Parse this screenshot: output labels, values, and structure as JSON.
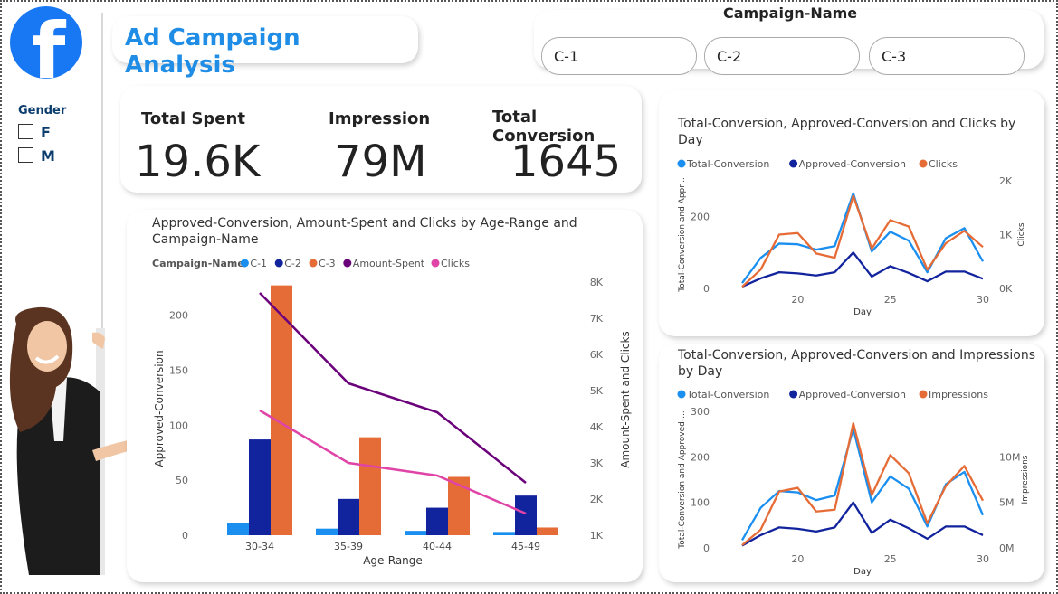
{
  "header": {
    "title": "Ad Campaign Analysis",
    "slicer_label": "Campaign-Name",
    "campaigns": [
      "C-1",
      "C-2",
      "C-3"
    ]
  },
  "sidebar": {
    "logo_icon": "facebook-logo-icon",
    "gender_label": "Gender",
    "gender_options": [
      "F",
      "M"
    ]
  },
  "kpis": [
    {
      "label": "Total Spent",
      "value": "19.6K"
    },
    {
      "label": "Impression",
      "value": "79M"
    },
    {
      "label": "Total Conversion",
      "value": "1645"
    }
  ],
  "colors": {
    "accent": "#1f8de6",
    "c1": "#1a8fef",
    "c2": "#12239e",
    "c3": "#e66c37",
    "amount_spent": "#6b007b",
    "clicks": "#e044a7"
  },
  "chart_data": [
    {
      "type": "bar",
      "title": "Approved-Conversion, Amount-Spent and Clicks by Age-Range and Campaign-Name",
      "legend_title": "Campaign-Name",
      "legend": [
        "C-1",
        "C-2",
        "C-3",
        "Amount-Spent",
        "Clicks"
      ],
      "categories": [
        "30-34",
        "35-39",
        "40-44",
        "45-49"
      ],
      "xlabel": "Age-Range",
      "ylabel": "Approved-Conversion",
      "y2label": "Amount-Spent and Clicks",
      "ylim": [
        0,
        230
      ],
      "yticks": [
        "0",
        "50",
        "100",
        "150",
        "200"
      ],
      "y2lim": [
        1000,
        8000
      ],
      "y2ticks": [
        "1K",
        "2K",
        "3K",
        "4K",
        "5K",
        "6K",
        "7K",
        "8K"
      ],
      "series": [
        {
          "name": "C-1",
          "values": [
            11,
            6,
            4,
            3
          ]
        },
        {
          "name": "C-2",
          "values": [
            87,
            33,
            25,
            36
          ]
        },
        {
          "name": "C-3",
          "values": [
            227,
            89,
            53,
            7
          ]
        },
        {
          "name": "Amount-Spent",
          "axis": "right",
          "values": [
            7700,
            5200,
            4400,
            2450
          ]
        },
        {
          "name": "Clicks",
          "axis": "right",
          "values": [
            4450,
            3000,
            2650,
            1600
          ]
        }
      ]
    },
    {
      "type": "line",
      "title": "Total-Conversion, Approved-Conversion and Clicks by Day",
      "legend": [
        "Total-Conversion",
        "Approved-Conversion",
        "Clicks"
      ],
      "xlabel": "Day",
      "ylabel": "Total-Conversion and Appr...",
      "y2label": "Clicks",
      "x": [
        17,
        18,
        19,
        20,
        21,
        22,
        23,
        24,
        25,
        26,
        27,
        28,
        29,
        30
      ],
      "xticks": [
        "20",
        "25",
        "30"
      ],
      "ylim": [
        0,
        300
      ],
      "yticks": [
        "0",
        "200"
      ],
      "y2lim": [
        0,
        2000
      ],
      "y2ticks": [
        "0K",
        "1K",
        "2K"
      ],
      "series": [
        {
          "name": "Total-Conversion",
          "values": [
            15,
            85,
            125,
            123,
            108,
            118,
            265,
            103,
            158,
            133,
            45,
            140,
            168,
            75
          ]
        },
        {
          "name": "Approved-Conversion",
          "values": [
            5,
            28,
            45,
            42,
            36,
            45,
            100,
            33,
            62,
            43,
            20,
            47,
            47,
            27
          ]
        },
        {
          "name": "Clicks",
          "axis": "right",
          "values": [
            30,
            350,
            1000,
            1030,
            650,
            570,
            1720,
            740,
            1270,
            1150,
            350,
            840,
            1070,
            770
          ]
        }
      ]
    },
    {
      "type": "line",
      "title": "Total-Conversion, Approved-Conversion and Impressions by Day",
      "legend": [
        "Total-Conversion",
        "Approved-Conversion",
        "Impressions"
      ],
      "xlabel": "Day",
      "ylabel": "Total-Conversion and Approved-...",
      "y2label": "Impressions",
      "x": [
        17,
        18,
        19,
        20,
        21,
        22,
        23,
        24,
        25,
        26,
        27,
        28,
        29,
        30
      ],
      "xticks": [
        "20",
        "25",
        "30"
      ],
      "ylim": [
        0,
        300
      ],
      "yticks": [
        "0",
        "100",
        "200",
        "300"
      ],
      "y2lim": [
        0,
        15000000
      ],
      "y2ticks": [
        "0M",
        "5M",
        "10M"
      ],
      "series": [
        {
          "name": "Total-Conversion",
          "values": [
            17,
            88,
            125,
            122,
            105,
            115,
            262,
            100,
            157,
            130,
            47,
            140,
            167,
            72
          ]
        },
        {
          "name": "Approved-Conversion",
          "values": [
            5,
            28,
            45,
            42,
            36,
            45,
            100,
            33,
            62,
            43,
            20,
            47,
            47,
            28
          ]
        },
        {
          "name": "Impressions",
          "axis": "right",
          "values": [
            300000,
            2000000,
            6200000,
            6600000,
            4000000,
            4200000,
            13700000,
            5800000,
            10200000,
            8200000,
            2700000,
            6800000,
            9000000,
            5200000
          ]
        }
      ]
    }
  ]
}
